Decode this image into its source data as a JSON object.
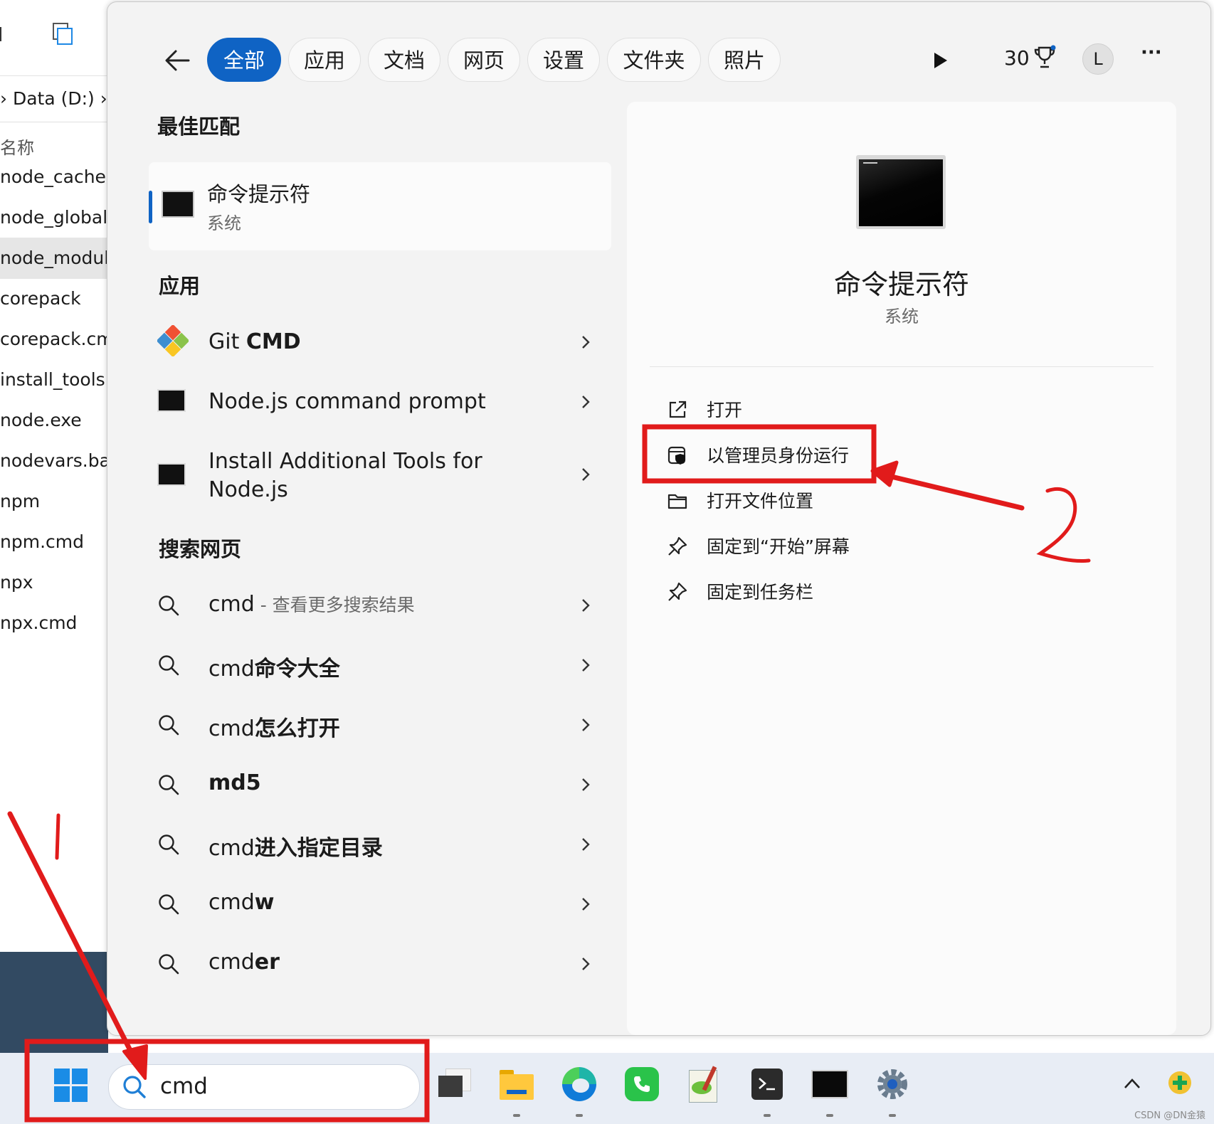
{
  "explorer": {
    "breadcrumb": "› Data (D:) › P",
    "column_header": "名称",
    "files": [
      "node_cache",
      "node_global",
      "node_modules",
      "corepack",
      "corepack.cmd",
      "install_tools.bat",
      "node.exe",
      "nodevars.bat",
      "npm",
      "npm.cmd",
      "npx",
      "npx.cmd"
    ]
  },
  "search_panel": {
    "tabs": [
      "全部",
      "应用",
      "文档",
      "网页",
      "设置",
      "文件夹",
      "照片"
    ],
    "active_tab": "全部",
    "points": "30",
    "avatar_letter": "L",
    "more_label": "···",
    "best_match": {
      "heading": "最佳匹配",
      "title": "命令提示符",
      "subtitle": "系统"
    },
    "apps": {
      "heading": "应用",
      "items": [
        {
          "label_pre": "Git ",
          "label_bold": "CMD"
        },
        {
          "label_pre": "Node.js command prompt",
          "label_bold": ""
        },
        {
          "label_line1": "Install Additional Tools for",
          "label_line2": "Node.js"
        }
      ]
    },
    "web": {
      "heading": "搜索网页",
      "items": [
        {
          "pre": "cmd",
          "bold": "",
          "suffix": " - 查看更多搜索结果"
        },
        {
          "pre": "cmd",
          "bold": "命令大全",
          "suffix": ""
        },
        {
          "pre": "cmd",
          "bold": "怎么打开",
          "suffix": ""
        },
        {
          "pre": "",
          "bold": "md5",
          "suffix": ""
        },
        {
          "pre": "cmd",
          "bold": "进入指定目录",
          "suffix": ""
        },
        {
          "pre": "cmd",
          "bold": "w",
          "suffix": ""
        },
        {
          "pre": "cmd",
          "bold": "er",
          "suffix": ""
        }
      ]
    },
    "detail": {
      "title": "命令提示符",
      "subtitle": "系统",
      "actions": [
        "打开",
        "以管理员身份运行",
        "打开文件位置",
        "固定到“开始”屏幕",
        "固定到任务栏"
      ]
    }
  },
  "taskbar": {
    "search_value": "cmd",
    "icons": [
      "task-view-icon",
      "file-explorer-icon",
      "edge-icon",
      "phone-link-icon",
      "notepad-plus-icon",
      "terminal-icon",
      "command-prompt-icon",
      "settings-icon"
    ],
    "tray": [
      "chevron-up-icon",
      "tray-app-icon"
    ]
  },
  "watermark": "CSDN @DN金猿",
  "colors": {
    "accent": "#0f63c4",
    "annotation": "#e11b1b",
    "taskbar": "#e8edf5",
    "panel": "#f3f3f3"
  }
}
